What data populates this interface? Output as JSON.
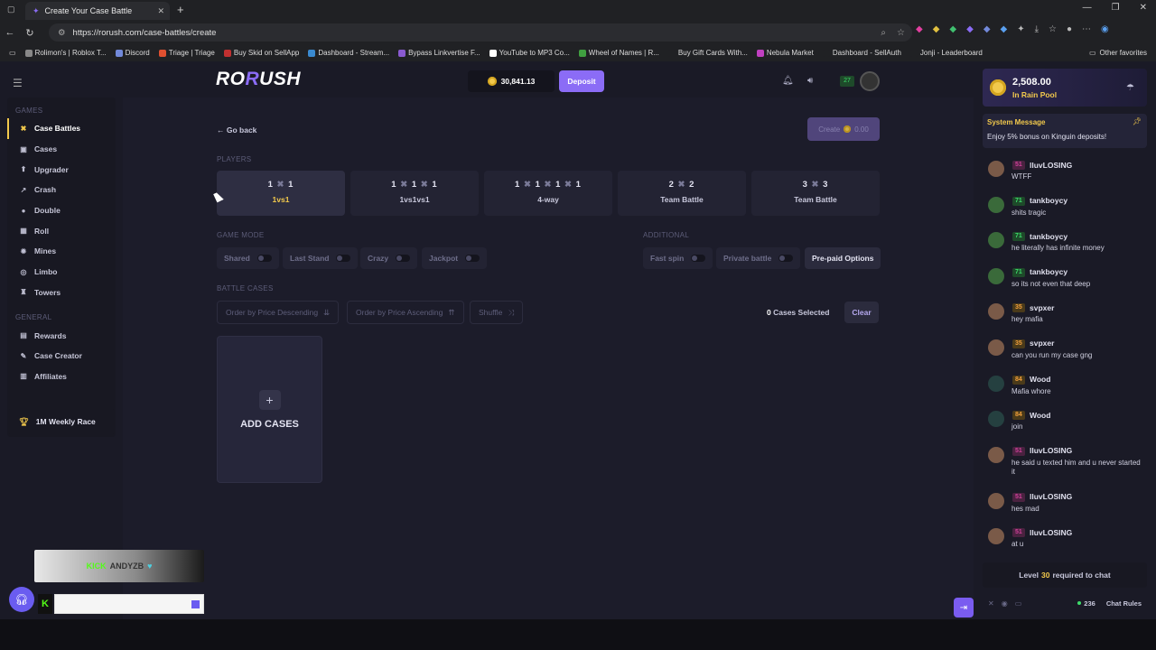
{
  "browser": {
    "tab_title": "Create Your Case Battle",
    "url": "https://rorush.com/case-battles/create",
    "bookmarks": [
      "Rolimon's | Roblox T...",
      "Discord",
      "Triage | Triage",
      "Buy Skid on SellApp",
      "Dashboard - Stream...",
      "Bypass Linkvertise F...",
      "YouTube to MP3 Co...",
      "Wheel of Names | R...",
      "Buy Gift Cards With...",
      "Nebula Market",
      "Dashboard - SellAuth",
      "Jonji - Leaderboard"
    ],
    "other_favorites": "Other favorites"
  },
  "header": {
    "logo_a": "RO",
    "logo_b": "R",
    "logo_c": "USH",
    "balance": "30,841.13",
    "deposit_label": "Deposit",
    "level": "27"
  },
  "sidebar": {
    "games_title": "GAMES",
    "games": [
      {
        "label": "Case Battles",
        "icon": "✖"
      },
      {
        "label": "Cases",
        "icon": "▣"
      },
      {
        "label": "Upgrader",
        "icon": "⬆"
      },
      {
        "label": "Crash",
        "icon": "↗"
      },
      {
        "label": "Double",
        "icon": "●"
      },
      {
        "label": "Roll",
        "icon": "▦"
      },
      {
        "label": "Mines",
        "icon": "✹"
      },
      {
        "label": "Limbo",
        "icon": "◎"
      },
      {
        "label": "Towers",
        "icon": "♜"
      }
    ],
    "general_title": "GENERAL",
    "general": [
      {
        "label": "Rewards",
        "icon": "▤"
      },
      {
        "label": "Case Creator",
        "icon": "✎"
      },
      {
        "label": "Affiliates",
        "icon": "▥"
      }
    ],
    "race": "1M Weekly Race"
  },
  "main": {
    "go_back": "Go back",
    "create_label": "Create",
    "create_cost": "0.00",
    "players_title": "PLAYERS",
    "players": [
      {
        "nums": [
          "1",
          "1"
        ],
        "name": "1vs1"
      },
      {
        "nums": [
          "1",
          "1",
          "1"
        ],
        "name": "1vs1vs1"
      },
      {
        "nums": [
          "1",
          "1",
          "1",
          "1"
        ],
        "name": "4-way"
      },
      {
        "nums": [
          "2",
          "2"
        ],
        "name": "Team Battle"
      },
      {
        "nums": [
          "3",
          "3"
        ],
        "name": "Team Battle"
      }
    ],
    "game_mode_title": "GAME MODE",
    "modes": [
      "Shared",
      "Last Stand",
      "Crazy",
      "Jackpot"
    ],
    "additional_title": "ADDITIONAL",
    "additional": [
      "Fast spin",
      "Private battle"
    ],
    "prepaid": "Pre-paid Options",
    "battle_cases_title": "BATTLE CASES",
    "sort_desc": "Order by Price Descending",
    "sort_asc": "Order by Price Ascending",
    "shuffle": "Shuffle",
    "cases_count": "0",
    "cases_selected": "Cases Selected",
    "clear": "Clear",
    "add_cases": "ADD CASES"
  },
  "chat": {
    "rain_amount": "2,508.00",
    "rain_label": "In Rain Pool",
    "system_title": "System Message",
    "system_text": "Enjoy 5% bonus on Kinguin deposits!",
    "messages": [
      {
        "level": "51",
        "color": "pink",
        "av": "",
        "name": "lluvLOSING",
        "text": "WTFF"
      },
      {
        "level": "71",
        "color": "green",
        "av": "green",
        "name": "tankboycy",
        "text": "shits tragic"
      },
      {
        "level": "71",
        "color": "green",
        "av": "green",
        "name": "tankboycy",
        "text": "he literally has infinite money"
      },
      {
        "level": "71",
        "color": "green",
        "av": "green",
        "name": "tankboycy",
        "text": "so its not even that deep"
      },
      {
        "level": "35",
        "color": "orange",
        "av": "",
        "name": "svpxer",
        "text": "hey mafia"
      },
      {
        "level": "35",
        "color": "orange",
        "av": "",
        "name": "svpxer",
        "text": "can you run my case gng"
      },
      {
        "level": "84",
        "color": "orange",
        "av": "dark",
        "name": "Wood",
        "text": "Mafia whore"
      },
      {
        "level": "84",
        "color": "orange",
        "av": "dark",
        "name": "Wood",
        "text": "join"
      },
      {
        "level": "51",
        "color": "pink",
        "av": "",
        "name": "lluvLOSING",
        "text": "he said u texted him and u never started it"
      },
      {
        "level": "51",
        "color": "pink",
        "av": "",
        "name": "lluvLOSING",
        "text": "hes mad"
      },
      {
        "level": "51",
        "color": "pink",
        "av": "",
        "name": "lluvLOSING",
        "text": "at u"
      }
    ],
    "req_a": "Level",
    "req_level": "30",
    "req_b": "required to chat",
    "online": "236",
    "rules": "Chat Rules"
  },
  "overlay": {
    "kick_word": "KICK",
    "streamer": "ANDYZB",
    "heart": "♥",
    "k": "K"
  }
}
